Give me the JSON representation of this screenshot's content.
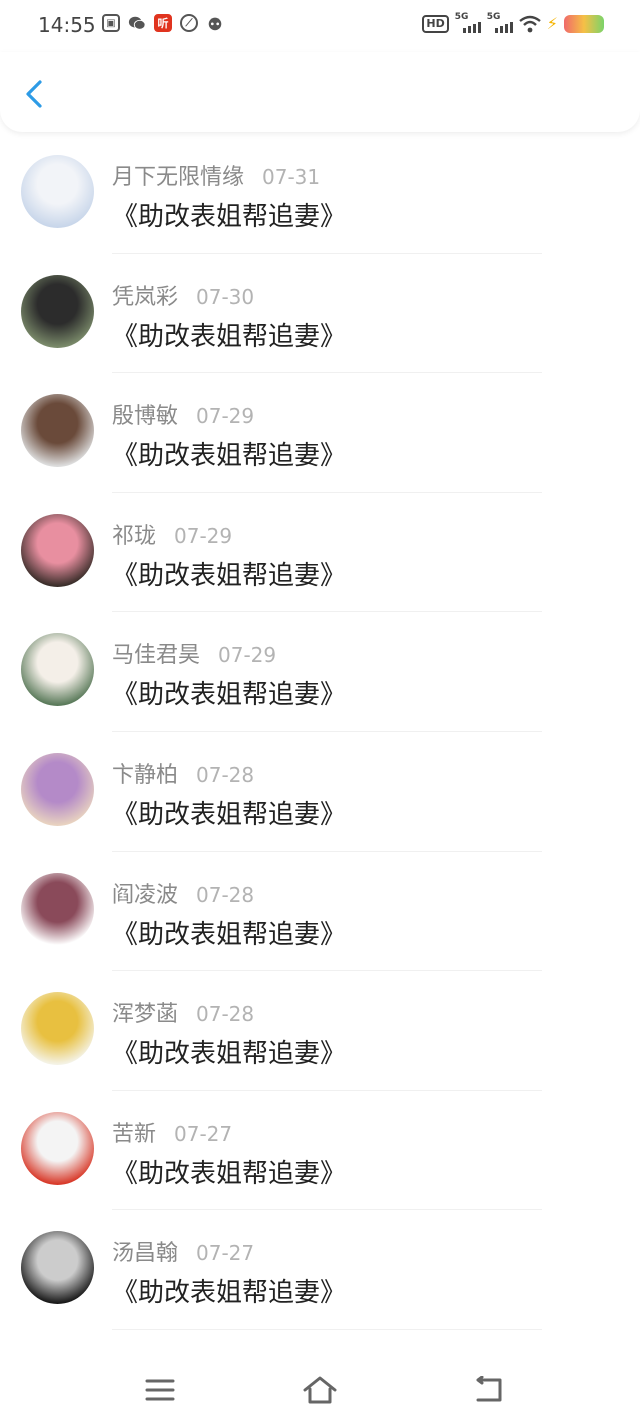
{
  "status_bar": {
    "time": "14:55",
    "left_icons": [
      "app-icon-1",
      "wechat-icon",
      "listen-app-icon",
      "link-app-icon",
      "cat-app-icon"
    ],
    "listen_label": "听",
    "hd_label": "HD",
    "signal_labels": [
      "5G",
      "5G"
    ],
    "battery_colors": [
      "#f06a6a",
      "#f5c046",
      "#7bd36a"
    ]
  },
  "header": {
    "back_icon": "chevron-left-icon",
    "accent_color": "#2d9be6"
  },
  "messages": [
    {
      "name": "月下无限情缘",
      "date": "07-31",
      "text": "《助改表姐帮追妻》",
      "avatar_colors": [
        "#c8d6ea",
        "#f2f4f8"
      ]
    },
    {
      "name": "凭岚彩",
      "date": "07-30",
      "text": "《助改表姐帮追妻》",
      "avatar_colors": [
        "#7a8a6a",
        "#2c2c2c"
      ]
    },
    {
      "name": "殷博敏",
      "date": "07-29",
      "text": "《助改表姐帮追妻》",
      "avatar_colors": [
        "#dcdcdc",
        "#6a4a3a"
      ]
    },
    {
      "name": "祁珑",
      "date": "07-29",
      "text": "《助改表姐帮追妻》",
      "avatar_colors": [
        "#3a2e2a",
        "#e88fa0"
      ]
    },
    {
      "name": "马佳君昊",
      "date": "07-29",
      "text": "《助改表姐帮追妻》",
      "avatar_colors": [
        "#5a7a5a",
        "#f4efe8"
      ]
    },
    {
      "name": "卞静柏",
      "date": "07-28",
      "text": "《助改表姐帮追妻》",
      "avatar_colors": [
        "#e8d2c0",
        "#b48ac8"
      ]
    },
    {
      "name": "阎凌波",
      "date": "07-28",
      "text": "《助改表姐帮追妻》",
      "avatar_colors": [
        "#ffffff",
        "#8a4a5a"
      ]
    },
    {
      "name": "浑梦菡",
      "date": "07-28",
      "text": "《助改表姐帮追妻》",
      "avatar_colors": [
        "#f4f2e4",
        "#e8c040"
      ]
    },
    {
      "name": "苦新",
      "date": "07-27",
      "text": "《助改表姐帮追妻》",
      "avatar_colors": [
        "#d83a2a",
        "#f4f4f4"
      ]
    },
    {
      "name": "汤昌翰",
      "date": "07-27",
      "text": "《助改表姐帮追妻》",
      "avatar_colors": [
        "#1a1a1a",
        "#cccccc"
      ]
    }
  ],
  "navbar": {
    "icons": [
      "menu-icon",
      "home-icon",
      "back-icon"
    ]
  }
}
